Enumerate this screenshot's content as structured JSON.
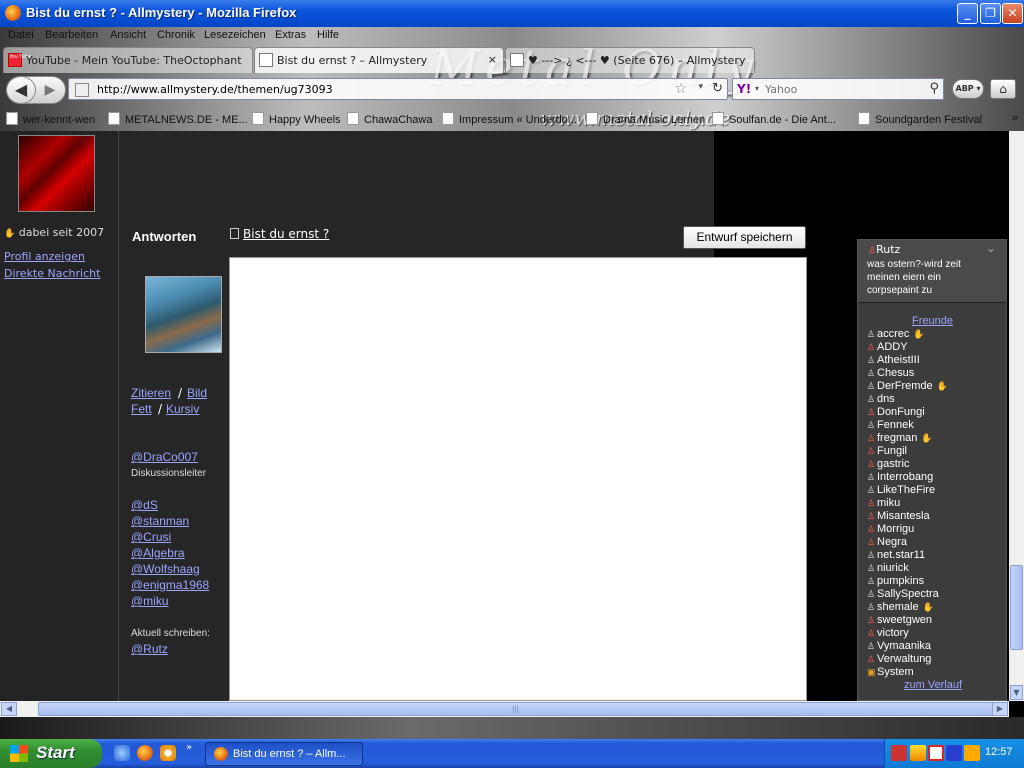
{
  "window": {
    "title": "Bist du ernst ? - Allmystery - Mozilla Firefox",
    "minimize": "_",
    "maximize": "❐",
    "close": "✕"
  },
  "menu": [
    "Datei",
    "Bearbeiten",
    "Ansicht",
    "Chronik",
    "Lesezeichen",
    "Extras",
    "Hilfe"
  ],
  "banner": {
    "text": "Metal Only",
    "url_text": "www.metal-only.de"
  },
  "tabs": [
    {
      "label": "YouTube - Mein YouTube: TheOctophant",
      "icon": "youtube-icon",
      "icon_text": "You Tube"
    },
    {
      "label": "Bist du ernst ? – Allmystery",
      "icon": "page-icon",
      "active": true
    },
    {
      "label": "♥ ---> ¿ <--- ♥ (Seite 676) – Allmystery",
      "icon": "page-icon"
    }
  ],
  "tab_close": "×",
  "nav": {
    "back": "◀",
    "forward": "▶",
    "url": "http://www.allmystery.de/themen/ug73093",
    "star": "☆",
    "dropdown": "▾",
    "reload": "↻",
    "search_engine": "Y!",
    "search_arrow": "▾",
    "search_placeholder": "Yahoo",
    "search_icon": "⚲",
    "abp": "ABP ▾",
    "home": "⌂"
  },
  "bookmarks": [
    {
      "label": "wer-kennt-wen"
    },
    {
      "label": "METALNEWS.DE - ME..."
    },
    {
      "label": "Happy Wheels"
    },
    {
      "label": "ChawaChawa"
    },
    {
      "label": "Impressum « Underdo..."
    },
    {
      "label": "Drama Music Lernen"
    },
    {
      "label": "Soulfan.de - Die Ant..."
    },
    {
      "label": "Soundgarden Festival"
    }
  ],
  "bookmarks_more": "»",
  "left": {
    "dabei_icon": "✋",
    "dabei": "dabei seit 2007",
    "profile_link": "Profil anzeigen",
    "message_link": "Direkte Nachricht"
  },
  "reply": {
    "heading": "Antworten",
    "thread_link": "Bist du ernst ?",
    "save_draft": "Entwurf speichern"
  },
  "formatting": {
    "quote": "Zitieren",
    "slash": "/",
    "image": "Bild",
    "bold": "Fett",
    "italic": "Kursiv"
  },
  "mentions": {
    "leader": "@DraCo007",
    "leader_role": "Diskussionsleiter",
    "users": [
      "@dS",
      "@stanman",
      "@Crusi",
      "@Algebra",
      "@Wolfshaag",
      "@enigma1968",
      "@miku"
    ],
    "currently_writing_label": "Aktuell schreiben:",
    "currently_writing": "@Rutz"
  },
  "chat": {
    "user": "Rutz",
    "expand": "⌄",
    "message": "was ostern?-wird zeit meinen eiern ein corpsepaint zu",
    "friends_heading": "Freunde",
    "friends": [
      {
        "name": "accrec",
        "status": "white",
        "wave": true
      },
      {
        "name": "ADDY",
        "status": "red"
      },
      {
        "name": "AtheistIII",
        "status": "white"
      },
      {
        "name": "Chesus",
        "status": "white"
      },
      {
        "name": "DerFremde",
        "status": "white",
        "wave": true
      },
      {
        "name": "dns",
        "status": "white"
      },
      {
        "name": "DonFungi",
        "status": "red"
      },
      {
        "name": "Fennek",
        "status": "white"
      },
      {
        "name": "fregman",
        "status": "red",
        "wave": true
      },
      {
        "name": "Fungil",
        "status": "red"
      },
      {
        "name": "gastric",
        "status": "red"
      },
      {
        "name": "Interrobang",
        "status": "white"
      },
      {
        "name": "LikeTheFire",
        "status": "white"
      },
      {
        "name": "miku",
        "status": "red"
      },
      {
        "name": "Misantesla",
        "status": "red"
      },
      {
        "name": "Morrigu",
        "status": "red"
      },
      {
        "name": "Negra",
        "status": "red"
      },
      {
        "name": "net.star11",
        "status": "white"
      },
      {
        "name": "niurick",
        "status": "white"
      },
      {
        "name": "pumpkins",
        "status": "white"
      },
      {
        "name": "SallySpectra",
        "status": "white"
      },
      {
        "name": "shemale",
        "status": "white",
        "wave": true
      },
      {
        "name": "sweetgwen",
        "status": "red"
      },
      {
        "name": "victory",
        "status": "red"
      },
      {
        "name": "Vymaanika",
        "status": "white"
      },
      {
        "name": "Verwaltung",
        "status": "red"
      },
      {
        "name": "System",
        "status": "orange"
      }
    ],
    "history_link": "zum Verlauf"
  },
  "scroll": {
    "up": "▲",
    "down": "▼",
    "left": "◀",
    "right": "▶",
    "grip": "|||"
  },
  "taskbar": {
    "start": "Start",
    "quicklaunch_more": "»",
    "task": "Bist du ernst ? – Allm...",
    "clock": "12:57"
  }
}
